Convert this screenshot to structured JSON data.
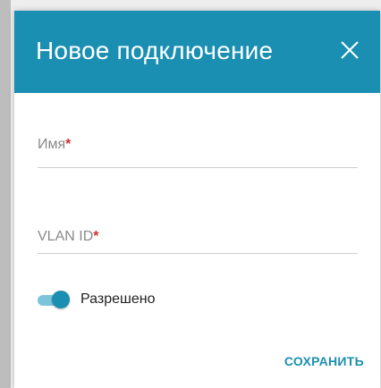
{
  "dialog": {
    "title": "Новое подключение",
    "close_icon": "close-icon"
  },
  "fields": [
    {
      "label": "Имя",
      "required_mark": "*",
      "value": ""
    },
    {
      "label": "VLAN ID",
      "required_mark": "*",
      "value": ""
    }
  ],
  "toggle": {
    "label": "Разрешено",
    "checked": true
  },
  "actions": {
    "save_label": "СОХРАНИТЬ"
  },
  "colors": {
    "accent": "#1a8fb2",
    "required": "#d32f2f"
  }
}
